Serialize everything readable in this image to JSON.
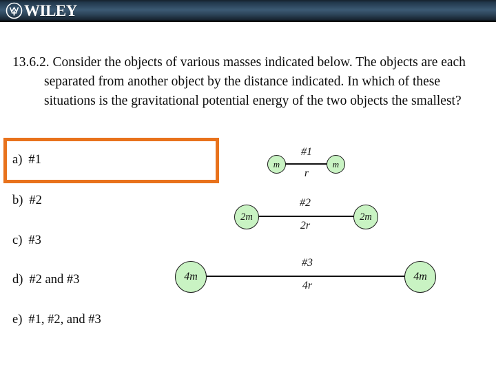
{
  "header": {
    "brand": "WILEY",
    "logo_icon": "wiley-circle-emblem-icon",
    "background_color": "#22384c",
    "text_color": "#ffffff"
  },
  "question": {
    "number": "13.6.2.",
    "text": "Consider the objects of various masses indicated below.  The objects are each separated from another object by the distance indicated.  In which of these situations is the gravitational potential energy of the two objects the smallest?"
  },
  "options": [
    {
      "letter": "a)",
      "label": "#1",
      "highlighted": true
    },
    {
      "letter": "b)",
      "label": "#2",
      "highlighted": false
    },
    {
      "letter": "c)",
      "label": "#3",
      "highlighted": false
    },
    {
      "letter": "d)",
      "label": "#2 and #3",
      "highlighted": false
    },
    {
      "letter": "e)",
      "label": "#1, #2, and #3",
      "highlighted": false
    }
  ],
  "highlight": {
    "border_color": "#e8721c"
  },
  "diagrams": [
    {
      "id": "#1",
      "top_label": "#1",
      "bottom_label": "r",
      "left_mass": "m",
      "right_mass": "m",
      "circle_color": "#c9f3c3"
    },
    {
      "id": "#2",
      "top_label": "#2",
      "bottom_label": "2r",
      "left_mass": "2m",
      "right_mass": "2m",
      "circle_color": "#c9f3c3"
    },
    {
      "id": "#3",
      "top_label": "#3",
      "bottom_label": "4r",
      "left_mass": "4m",
      "right_mass": "4m",
      "circle_color": "#c9f3c3"
    }
  ]
}
